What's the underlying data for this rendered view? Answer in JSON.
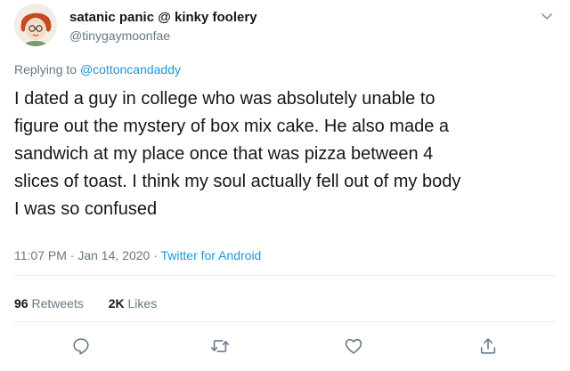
{
  "user": {
    "display_name": "satanic panic @ kinky foolery",
    "handle": "@tinygaymoonfae",
    "avatar_icon": "avatar-illustration-icon"
  },
  "reply": {
    "prefix": "Replying to",
    "mention": "@cottoncandaddy"
  },
  "tweet": {
    "lines": [
      "I dated a guy in college who was absolutely unable to",
      "figure out the mystery of box mix cake. He also made a",
      "sandwich at my place once that was pizza between 4",
      "slices of toast. I think my soul actually fell out of my body",
      "I was so confused"
    ]
  },
  "meta": {
    "time": "11:07 PM",
    "separator": " · ",
    "date": "Jan 14, 2020",
    "source": "Twitter for Android"
  },
  "stats": {
    "retweets_count": "96",
    "retweets_label": "Retweets",
    "likes_count": "2K",
    "likes_label": "Likes"
  },
  "actions": {
    "reply_icon": "reply-icon",
    "retweet_icon": "retweet-icon",
    "like_icon": "heart-icon",
    "share_icon": "share-icon"
  },
  "colors": {
    "link": "#1b95e0",
    "secondary": "#657786",
    "text": "#14171a",
    "divider": "#e6ecf0"
  }
}
